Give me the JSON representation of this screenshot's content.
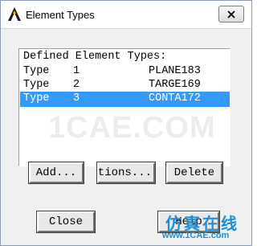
{
  "window": {
    "title": "Element Types",
    "icon": "ansys-logo-icon"
  },
  "list": {
    "header": "Defined Element Types:",
    "rows": [
      {
        "label": "Type",
        "number": "1",
        "name": "PLANE183",
        "selected": false
      },
      {
        "label": "Type",
        "number": "2",
        "name": "TARGE169",
        "selected": false
      },
      {
        "label": "Type",
        "number": "3",
        "name": "CONTA172",
        "selected": true
      }
    ]
  },
  "buttons": {
    "add": "Add...",
    "options": "Options...",
    "delete": "Delete",
    "close": "Close",
    "help": "Help"
  },
  "watermark": "1CAE.COM",
  "brand": {
    "cn": "仿真在线",
    "url": "www.1CAE.com"
  },
  "colors": {
    "selection": "#3399ff",
    "brand": "#1d8fd6"
  }
}
